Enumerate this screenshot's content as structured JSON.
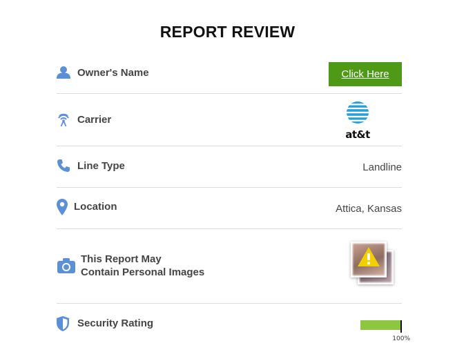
{
  "title": "REPORT REVIEW",
  "rows": {
    "owner": {
      "label": "Owner's Name",
      "button_label": "Click Here",
      "icon": "user-icon"
    },
    "carrier": {
      "label": "Carrier",
      "logo_text": "at&t",
      "icon": "antenna-icon"
    },
    "line_type": {
      "label": "Line Type",
      "value": "Landline",
      "icon": "phone-icon"
    },
    "location": {
      "label": "Location",
      "value": "Attica, Kansas",
      "icon": "map-pin-icon"
    },
    "images": {
      "label_line1": "This Report May",
      "label_line2": "Contain Personal Images",
      "icon": "camera-icon"
    },
    "security": {
      "label": "Security Rating",
      "value_text": "100%",
      "rating": 1.0,
      "icon": "shield-icon"
    }
  },
  "colors": {
    "icon": "#5b8fd8",
    "button": "#4e9a17",
    "rating": "#8dc63f",
    "att_blue": "#2a9fd8"
  }
}
